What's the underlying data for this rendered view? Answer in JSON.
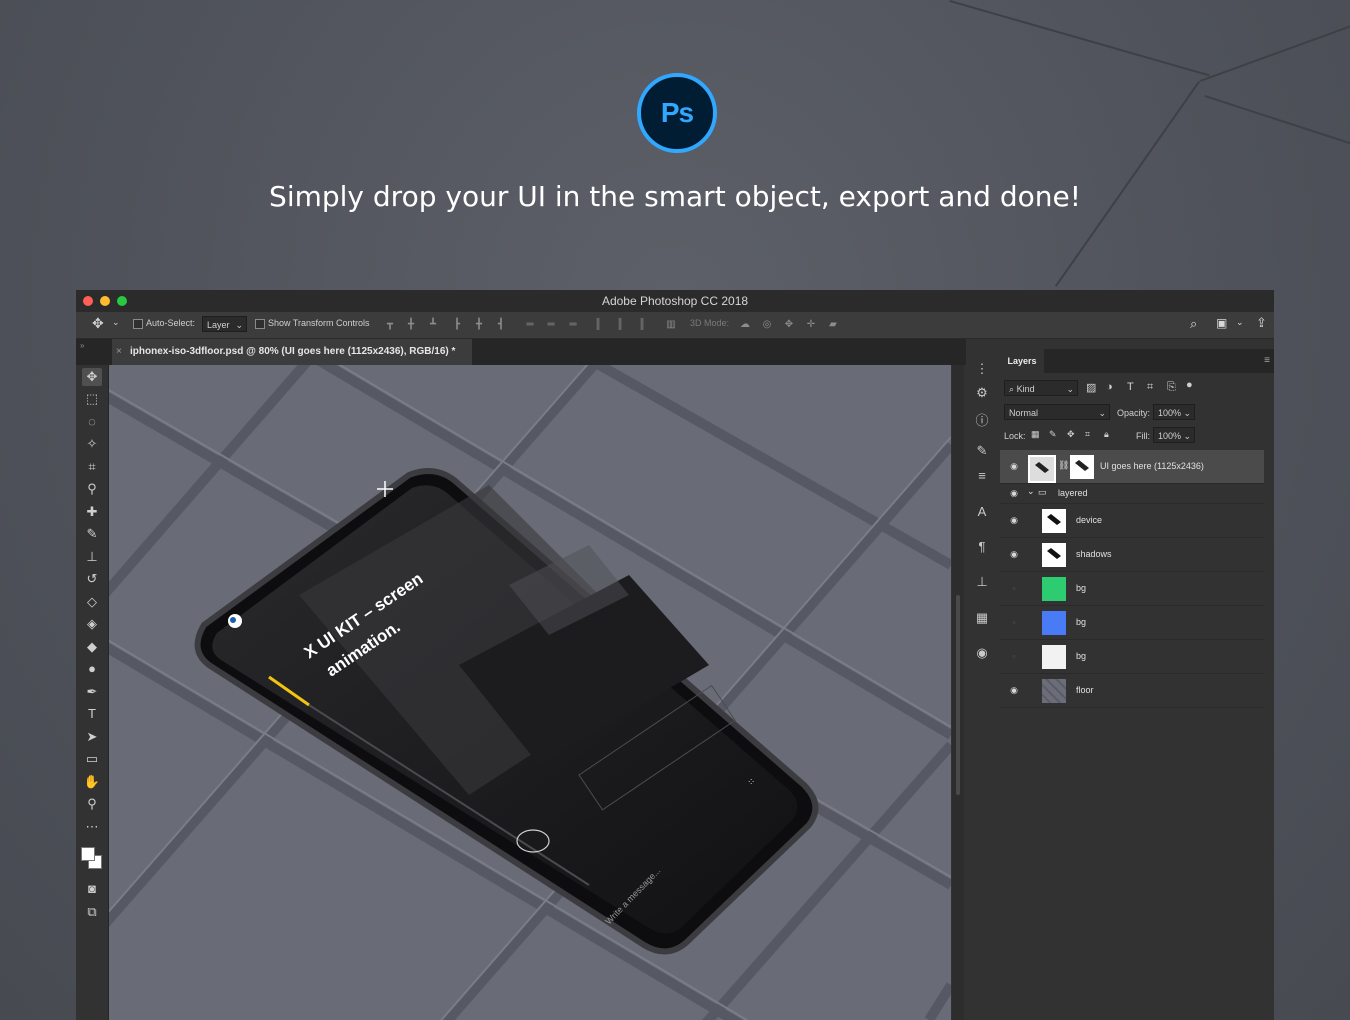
{
  "headline": "Simply drop your UI in the smart object, export and done!",
  "logo": {
    "text": "Ps",
    "color": "#31a8ff",
    "background": "#001d34"
  },
  "window": {
    "title": "Adobe Photoshop CC 2018",
    "traffic_lights": [
      "#ff5f57",
      "#febc2e",
      "#28c840"
    ]
  },
  "options_bar": {
    "auto_select_label": "Auto-Select:",
    "auto_select_value": "Layer",
    "show_transform_label": "Show Transform Controls",
    "mode_3d_label": "3D Mode:"
  },
  "document_tab": {
    "close_glyph": "×",
    "title": "iphonex-iso-3dfloor.psd @ 80% (UI goes here (1125x2436), RGB/16) *"
  },
  "phone_screen": {
    "headline_line1": "X UI KIT – screen",
    "headline_line2": "animation.",
    "message_placeholder": "Write a message..."
  },
  "layers_panel": {
    "tab": "Layers",
    "filter_label": "Kind",
    "blend_mode": "Normal",
    "opacity_label": "Opacity:",
    "opacity_value": "100%",
    "lock_label": "Lock:",
    "fill_label": "Fill:",
    "fill_value": "100%",
    "layers": [
      {
        "name": "UI goes here (1125x2436)",
        "visible": true,
        "selected": true,
        "thumb": "smart"
      },
      {
        "name": "layered",
        "visible": true,
        "group": true
      },
      {
        "name": "device",
        "visible": true,
        "thumb": "smart"
      },
      {
        "name": "shadows",
        "visible": true,
        "thumb": "smart"
      },
      {
        "name": "bg",
        "visible": false,
        "thumb": "#2ecc71"
      },
      {
        "name": "bg",
        "visible": false,
        "thumb": "#4a7bf7"
      },
      {
        "name": "bg",
        "visible": false,
        "thumb": "#f2f2f2"
      },
      {
        "name": "floor",
        "visible": true,
        "thumb": "floor"
      }
    ]
  }
}
